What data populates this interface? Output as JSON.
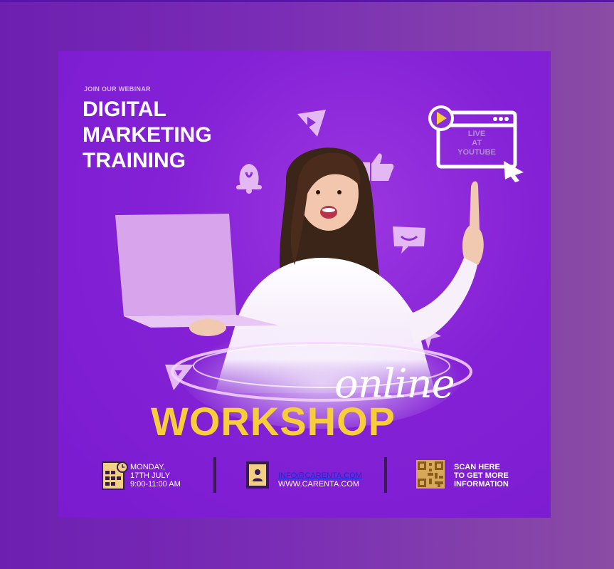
{
  "header": {
    "kicker": "JOIN OUR WEBINAR",
    "title_lines": [
      "DIGITAL",
      "MARKETING",
      "TRAINING"
    ]
  },
  "live_badge": {
    "lines": [
      "LIVE",
      "AT",
      "YOUTUBE"
    ]
  },
  "headline": {
    "script": "online",
    "main": "WORKSHOP"
  },
  "footer": {
    "date": {
      "day": "MONDAY,",
      "date": "17TH JULY",
      "time": "9:00-11:00 AM"
    },
    "contact": {
      "email": "INFO@CARENTA.COM",
      "website": "WWW.CARENTA.COM"
    },
    "scan": {
      "lines": [
        "SCAN HERE",
        "TO GET MORE",
        "INFORMATION"
      ]
    }
  },
  "colors": {
    "accent_yellow": "#f7cd3a",
    "card_purple": "#8421d6",
    "icon_lilac": "#e3b8f3",
    "footer_icon": "#f1d083"
  },
  "icons": [
    "play-icon",
    "like-icon",
    "bell-icon",
    "chat-icon",
    "cursor-icon",
    "calendar-icon",
    "document-icon",
    "qr-code-icon"
  ]
}
